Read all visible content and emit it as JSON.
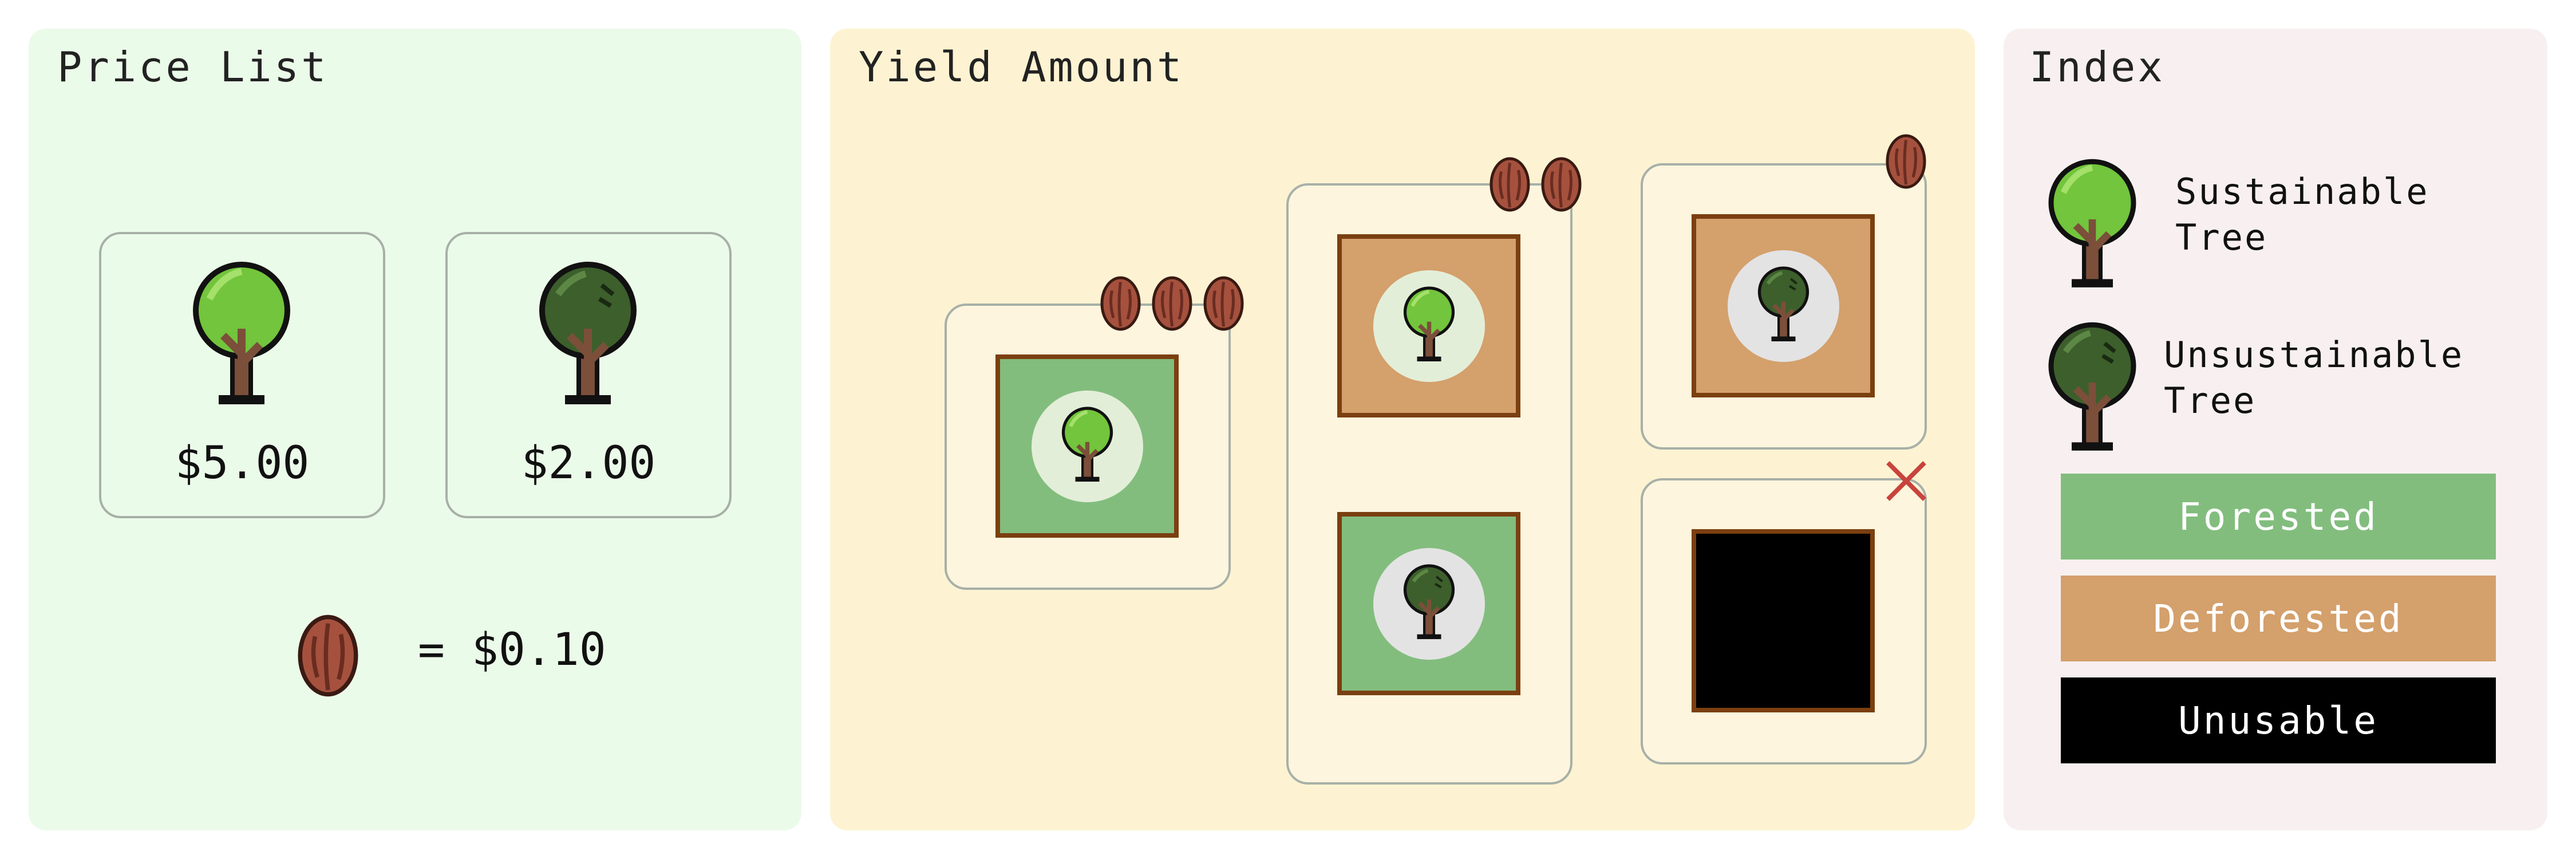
{
  "panels": {
    "price_list": {
      "title": "Price List",
      "sustainable_price": "$5.00",
      "unsustainable_price": "$2.00",
      "seed_rate": "= $0.10"
    },
    "yield_amount": {
      "title": "Yield Amount",
      "plots": [
        {
          "land": "Forested",
          "tree": "Sustainable Tree",
          "seeds": 3
        },
        {
          "land": "Deforested",
          "tree": "Sustainable Tree",
          "seeds": 2
        },
        {
          "land": "Forested",
          "tree": "Unsustainable Tree",
          "seeds": 2
        },
        {
          "land": "Deforested",
          "tree": "Unsustainable Tree",
          "seeds": 1
        },
        {
          "land": "Unusable",
          "tree": "none",
          "seeds": 0,
          "marker": "cross-icon"
        }
      ]
    },
    "index": {
      "title": "Index",
      "sustainable_line1": "Sustainable",
      "sustainable_line2": "Tree",
      "unsustainable_line1": "Unsustainable",
      "unsustainable_line2": "Tree",
      "forested": "Forested",
      "deforested": "Deforested",
      "unusable": "Unusable"
    }
  },
  "colors": {
    "forested": "#82bd7e",
    "deforested": "#d4a06c",
    "unusable": "#000000",
    "price_panel": "#ebfbe9",
    "yield_panel": "#fdf3d2",
    "index_panel": "#f8f0f0",
    "sustainable_canopy": "#72c53c",
    "unsustainable_canopy": "#3d5f2c",
    "seed": "#a5513e",
    "cross": "#c8443c"
  },
  "icons": {
    "sustainable_tree": "sustainable-tree-icon",
    "unsustainable_tree": "unsustainable-tree-icon",
    "seed": "seed-icon",
    "unusable_marker": "cross-icon"
  }
}
